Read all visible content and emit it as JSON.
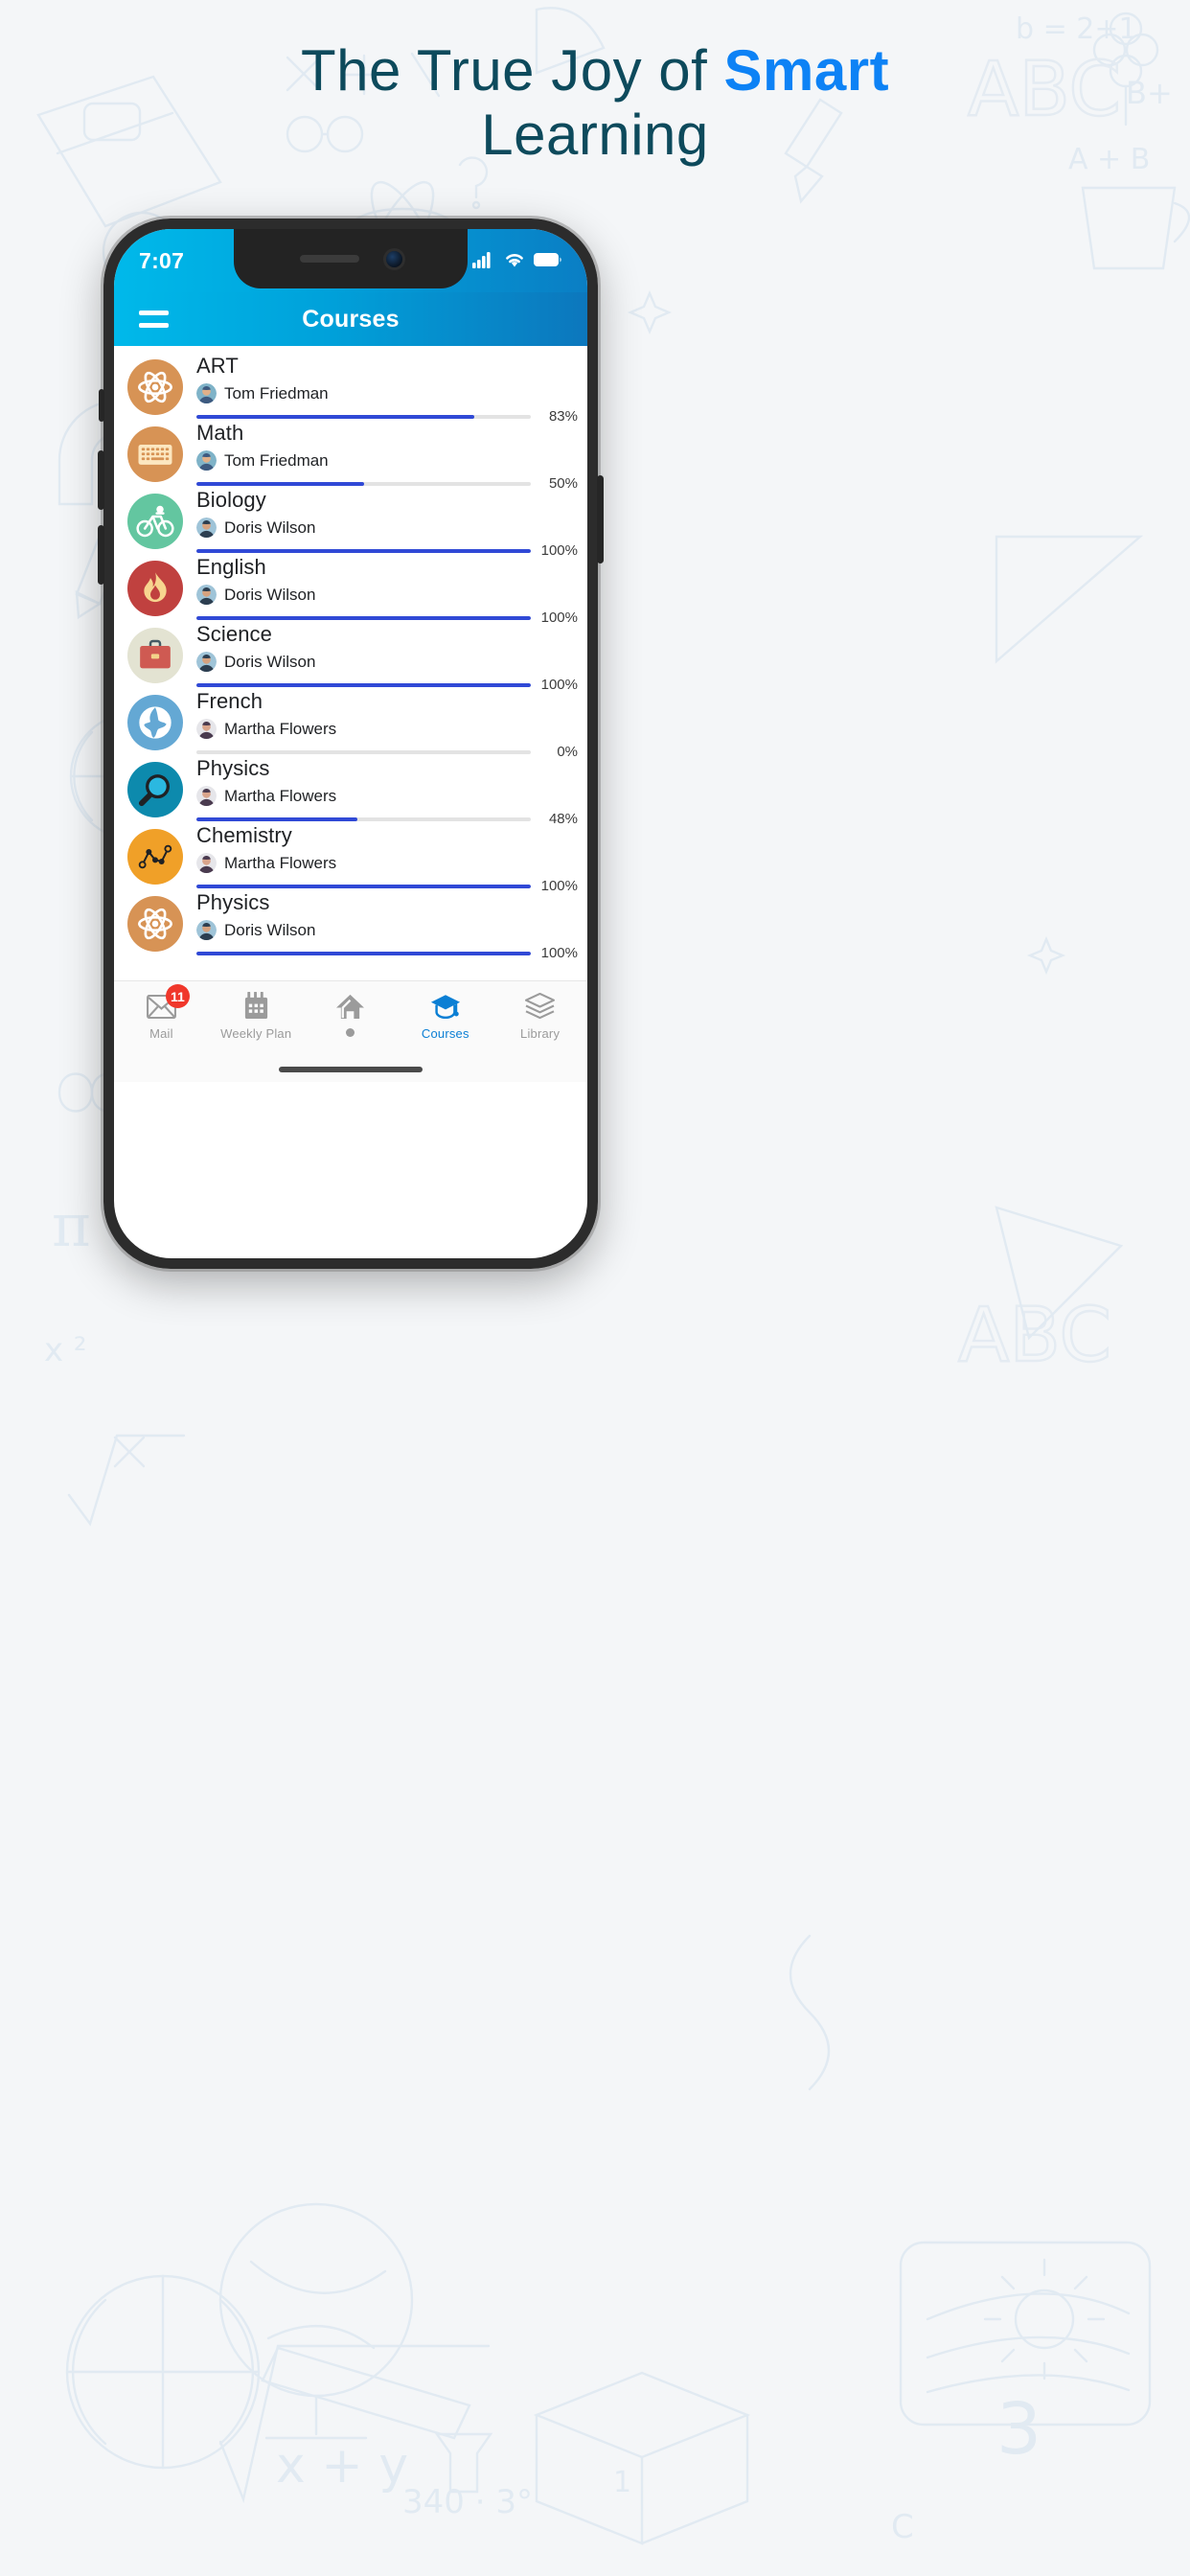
{
  "promo": {
    "line1_pre": "The True Joy of ",
    "line1_accent": "Smart",
    "line2": "Learning",
    "heading_color": "#0d4a5c",
    "accent_color": "#0d82f5"
  },
  "phone": {
    "status": {
      "time": "7:07",
      "icons": [
        "signal-bars-icon",
        "wifi-icon",
        "battery-icon"
      ]
    },
    "appbar": {
      "menu_icon": "hamburger-menu-icon",
      "title": "Courses",
      "gradient_from": "#00b9ea",
      "gradient_to": "#0c77bd"
    },
    "courses": [
      {
        "name": "ART",
        "teacher": "Tom Friedman",
        "progress": 83,
        "progress_label": "83%",
        "icon": "atom-icon",
        "icon_bg": "#d79355",
        "icon_fg": "#ffffff"
      },
      {
        "name": "Math",
        "teacher": "Tom Friedman",
        "progress": 50,
        "progress_label": "50%",
        "icon": "keyboard-icon",
        "icon_bg": "#d79355",
        "icon_fg": "#fce7c0"
      },
      {
        "name": "Biology",
        "teacher": "Doris Wilson",
        "progress": 100,
        "progress_label": "100%",
        "icon": "bicycle-icon",
        "icon_bg": "#63c6a0",
        "icon_fg": "#ffffff"
      },
      {
        "name": "English",
        "teacher": "Doris Wilson",
        "progress": 100,
        "progress_label": "100%",
        "icon": "flame-icon",
        "icon_bg": "#c0413f",
        "icon_fg": "#f7d58f"
      },
      {
        "name": "Science",
        "teacher": "Doris Wilson",
        "progress": 100,
        "progress_label": "100%",
        "icon": "briefcase-icon",
        "icon_bg": "#e3e3d2",
        "icon_fg": "#cf5a52"
      },
      {
        "name": "French",
        "teacher": "Martha Flowers",
        "progress": 0,
        "progress_label": "0%",
        "icon": "globe-icon",
        "icon_bg": "#64a8d4",
        "icon_fg": "#ffffff"
      },
      {
        "name": "Physics",
        "teacher": "Martha Flowers",
        "progress": 48,
        "progress_label": "48%",
        "icon": "magnifier-icon",
        "icon_bg": "#0d8aad",
        "icon_fg": "#1f2124"
      },
      {
        "name": "Chemistry",
        "teacher": "Martha Flowers",
        "progress": 100,
        "progress_label": "100%",
        "icon": "linechart-icon",
        "icon_bg": "#f0a028",
        "icon_fg": "#1f2124"
      },
      {
        "name": "Physics",
        "teacher": "Doris Wilson",
        "progress": 100,
        "progress_label": "100%",
        "icon": "atom-icon",
        "icon_bg": "#d79355",
        "icon_fg": "#ffffff"
      }
    ],
    "progress_fill_color": "#3049d6",
    "progress_track_color": "#e3e3e3",
    "tabs": [
      {
        "label": "Mail",
        "icon": "mail-icon",
        "badge": "11",
        "active": false
      },
      {
        "label": "Weekly Plan",
        "icon": "calendar-icon",
        "badge": "",
        "active": false
      },
      {
        "label": "",
        "icon": "home-icon",
        "badge": "",
        "active": false
      },
      {
        "label": "Courses",
        "icon": "graduation-cap-icon",
        "badge": "",
        "active": true
      },
      {
        "label": "Library",
        "icon": "books-icon",
        "badge": "",
        "active": false
      }
    ],
    "tab_active_color": "#0b7fd4",
    "tab_inactive_color": "#9b9b9b",
    "badge_color": "#f0372b"
  }
}
